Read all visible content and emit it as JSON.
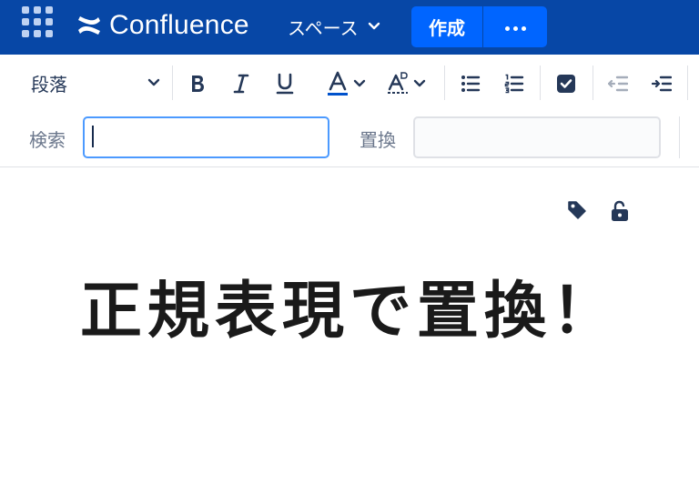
{
  "topbar": {
    "app_name": "Confluence",
    "spaces_label": "スペース",
    "create_label": "作成"
  },
  "toolbar": {
    "paragraph_style": "段落"
  },
  "find_replace": {
    "find_label": "検索",
    "find_value": "",
    "replace_label": "置換",
    "replace_value": ""
  },
  "page": {
    "title": "正規表現で置換！"
  },
  "colors": {
    "nav_background": "#0747A6",
    "primary_button": "#0065FF",
    "focus_border": "#4C9AFF",
    "text_color_underline": "#0052CC"
  }
}
